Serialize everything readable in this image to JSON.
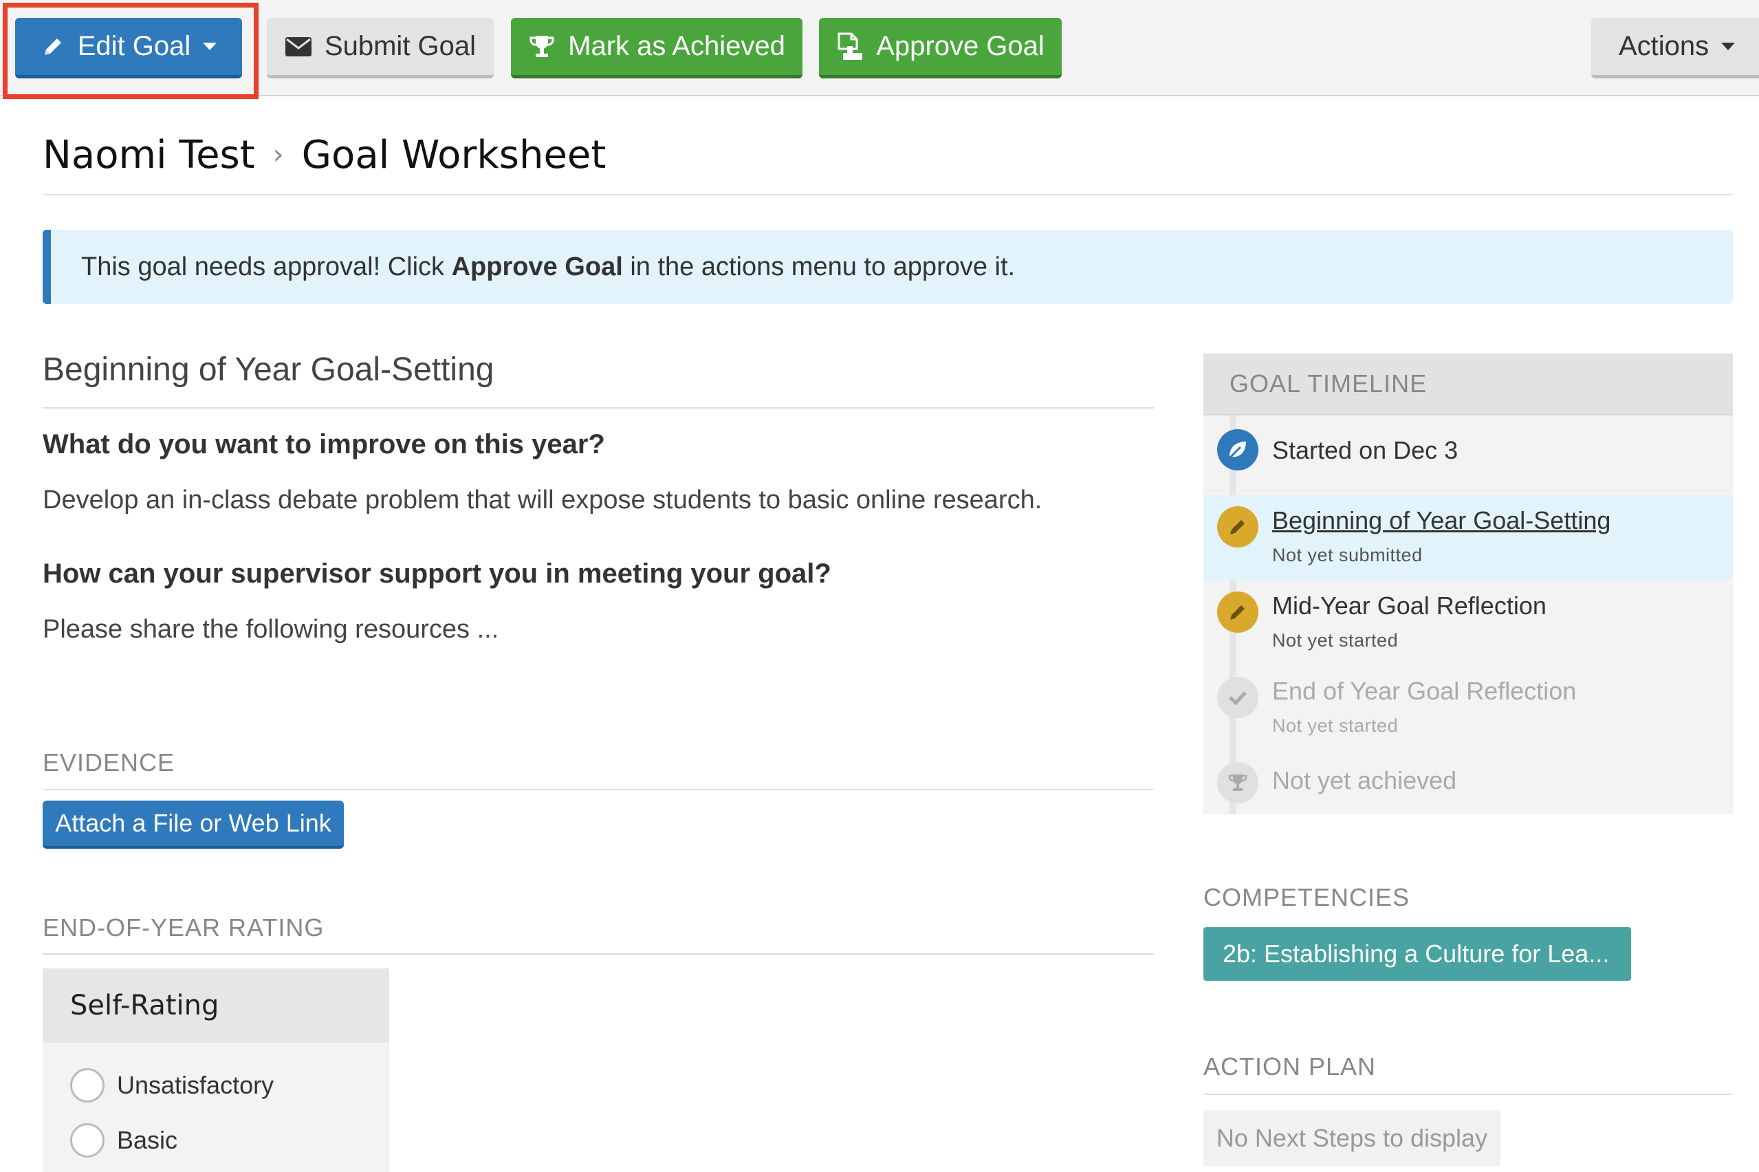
{
  "toolbar": {
    "edit_label": "Edit Goal",
    "submit_label": "Submit Goal",
    "achieve_label": "Mark as Achieved",
    "approve_label": "Approve Goal",
    "actions_label": "Actions"
  },
  "header": {
    "person": "Naomi Test",
    "separator": "›",
    "page_title": "Goal Worksheet"
  },
  "alert": {
    "before": "This goal needs approval! Click ",
    "strong": "Approve Goal",
    "after": " in the actions menu to approve it."
  },
  "worksheet": {
    "section_title": "Beginning of Year Goal-Setting",
    "questions": [
      {
        "question": "What do you want to improve on this year?",
        "answer": "Develop an in-class debate problem that will expose students to basic online research."
      },
      {
        "question": "How can your supervisor support you in meeting your goal?",
        "answer": "Please share the following resources ..."
      }
    ]
  },
  "evidence": {
    "label": "EVIDENCE",
    "attach_label": "Attach a File or Web Link"
  },
  "end_of_year": {
    "label": "END-OF-YEAR RATING",
    "card_title": "Self-Rating",
    "options": [
      "Unsatisfactory",
      "Basic"
    ]
  },
  "timeline": {
    "title": "GOAL TIMELINE",
    "items": [
      {
        "title": "Started on Dec 3",
        "subtitle": "",
        "icon": "leaf-icon",
        "color": "#2f79bd"
      },
      {
        "title": "Beginning of Year Goal-Setting",
        "subtitle": "Not yet submitted",
        "icon": "pencil-icon",
        "color": "#d9a92c"
      },
      {
        "title": "Mid-Year Goal Reflection",
        "subtitle": "Not yet started",
        "icon": "pencil-icon",
        "color": "#d9a92c"
      },
      {
        "title": "End of Year Goal Reflection",
        "subtitle": "Not yet started",
        "icon": "check-icon",
        "color": "#e0e0e0"
      },
      {
        "title": "Not yet achieved",
        "subtitle": "",
        "icon": "trophy-icon",
        "color": "#e0e0e0"
      }
    ]
  },
  "competencies": {
    "label": "COMPETENCIES",
    "items": [
      "2b:  Establishing a Culture for Lea..."
    ]
  },
  "action_plan": {
    "label": "ACTION PLAN",
    "empty_text": "No Next Steps to display"
  },
  "colors": {
    "primary": "#2f79bd",
    "success": "#4aa53d",
    "teal": "#4aa3a3",
    "alert_bg": "#e2f3fc",
    "highlight": "#e8412c",
    "pending": "#d9a92c"
  }
}
